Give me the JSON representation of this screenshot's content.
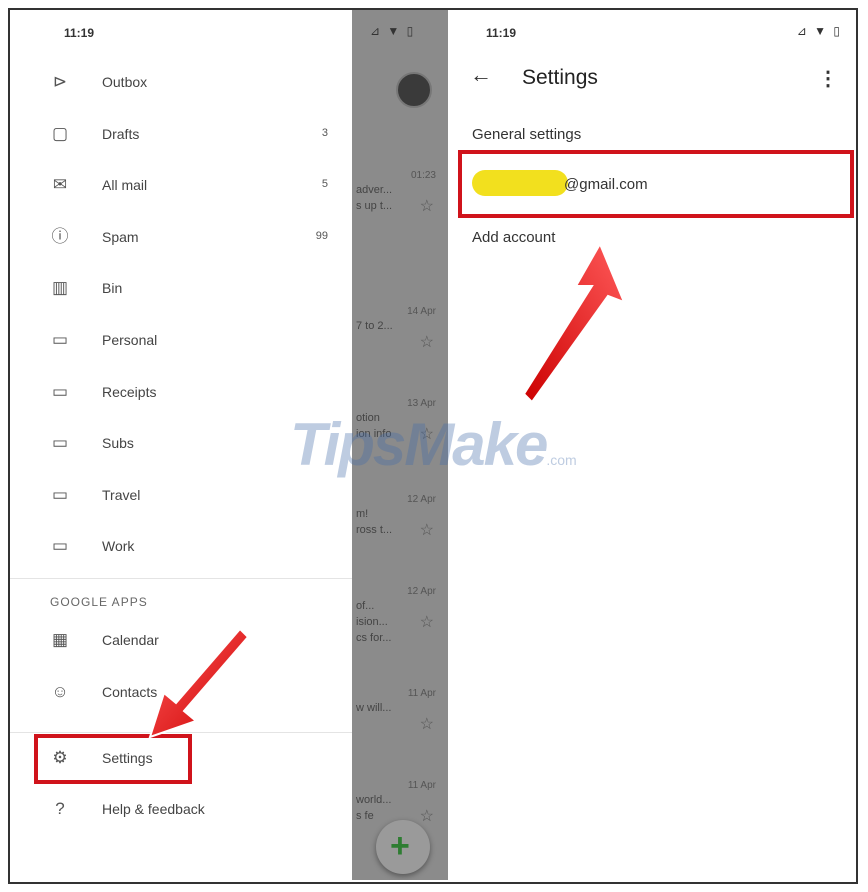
{
  "left_phone": {
    "time": "11:19",
    "status_icons": "⊿ ▼ ▯",
    "nav_items": [
      {
        "label": "Outbox",
        "count": "",
        "icon": "outbox-icon",
        "glyph": "⊳"
      },
      {
        "label": "Drafts",
        "count": "3",
        "icon": "draft-icon",
        "glyph": "▢"
      },
      {
        "label": "All mail",
        "count": "5",
        "icon": "all-mail-icon",
        "glyph": "✉"
      },
      {
        "label": "Spam",
        "count": "99",
        "icon": "spam-icon",
        "glyph": "ⓘ"
      },
      {
        "label": "Bin",
        "count": "",
        "icon": "bin-icon",
        "glyph": "▥"
      },
      {
        "label": "Personal",
        "count": "",
        "icon": "label-icon",
        "glyph": "▭"
      },
      {
        "label": "Receipts",
        "count": "",
        "icon": "label-icon",
        "glyph": "▭"
      },
      {
        "label": "Subs",
        "count": "",
        "icon": "label-icon",
        "glyph": "▭"
      },
      {
        "label": "Travel",
        "count": "",
        "icon": "label-icon",
        "glyph": "▭"
      },
      {
        "label": "Work",
        "count": "",
        "icon": "label-icon",
        "glyph": "▭"
      }
    ],
    "section_google_apps": "GOOGLE APPS",
    "app_items": [
      {
        "label": "Calendar",
        "icon": "calendar-icon",
        "glyph": "▦"
      },
      {
        "label": "Contacts",
        "icon": "contacts-icon",
        "glyph": "☺"
      }
    ],
    "settings_label": "Settings",
    "help_label": "Help & feedback",
    "strip": {
      "rows": [
        {
          "date": "01:23",
          "lines": [
            "adver...",
            "s up t..."
          ]
        },
        {
          "date": "14 Apr",
          "lines": [
            "7 to 2..."
          ]
        },
        {
          "date": "13 Apr",
          "lines": [
            "otion",
            "ion info"
          ]
        },
        {
          "date": "12 Apr",
          "lines": [
            "m!",
            "ross t..."
          ]
        },
        {
          "date": "12 Apr",
          "lines": [
            "of...",
            "ision...",
            "cs for..."
          ]
        },
        {
          "date": "11 Apr",
          "lines": [
            "w will..."
          ]
        },
        {
          "date": "11 Apr",
          "lines": [
            "world...",
            "s fe"
          ]
        }
      ],
      "fab_glyph": "+"
    }
  },
  "right_phone": {
    "time": "11:19",
    "status_icons": "⊿ ▼ ▯",
    "title": "Settings",
    "general_settings": "General settings",
    "email_suffix": "@gmail.com",
    "add_account": "Add account"
  },
  "watermark": {
    "main": "TipsMake",
    "suffix": ".com"
  },
  "colors": {
    "highlight": "#d0131b",
    "blur": "#f2e01e",
    "strip": "#8b8b8b"
  }
}
